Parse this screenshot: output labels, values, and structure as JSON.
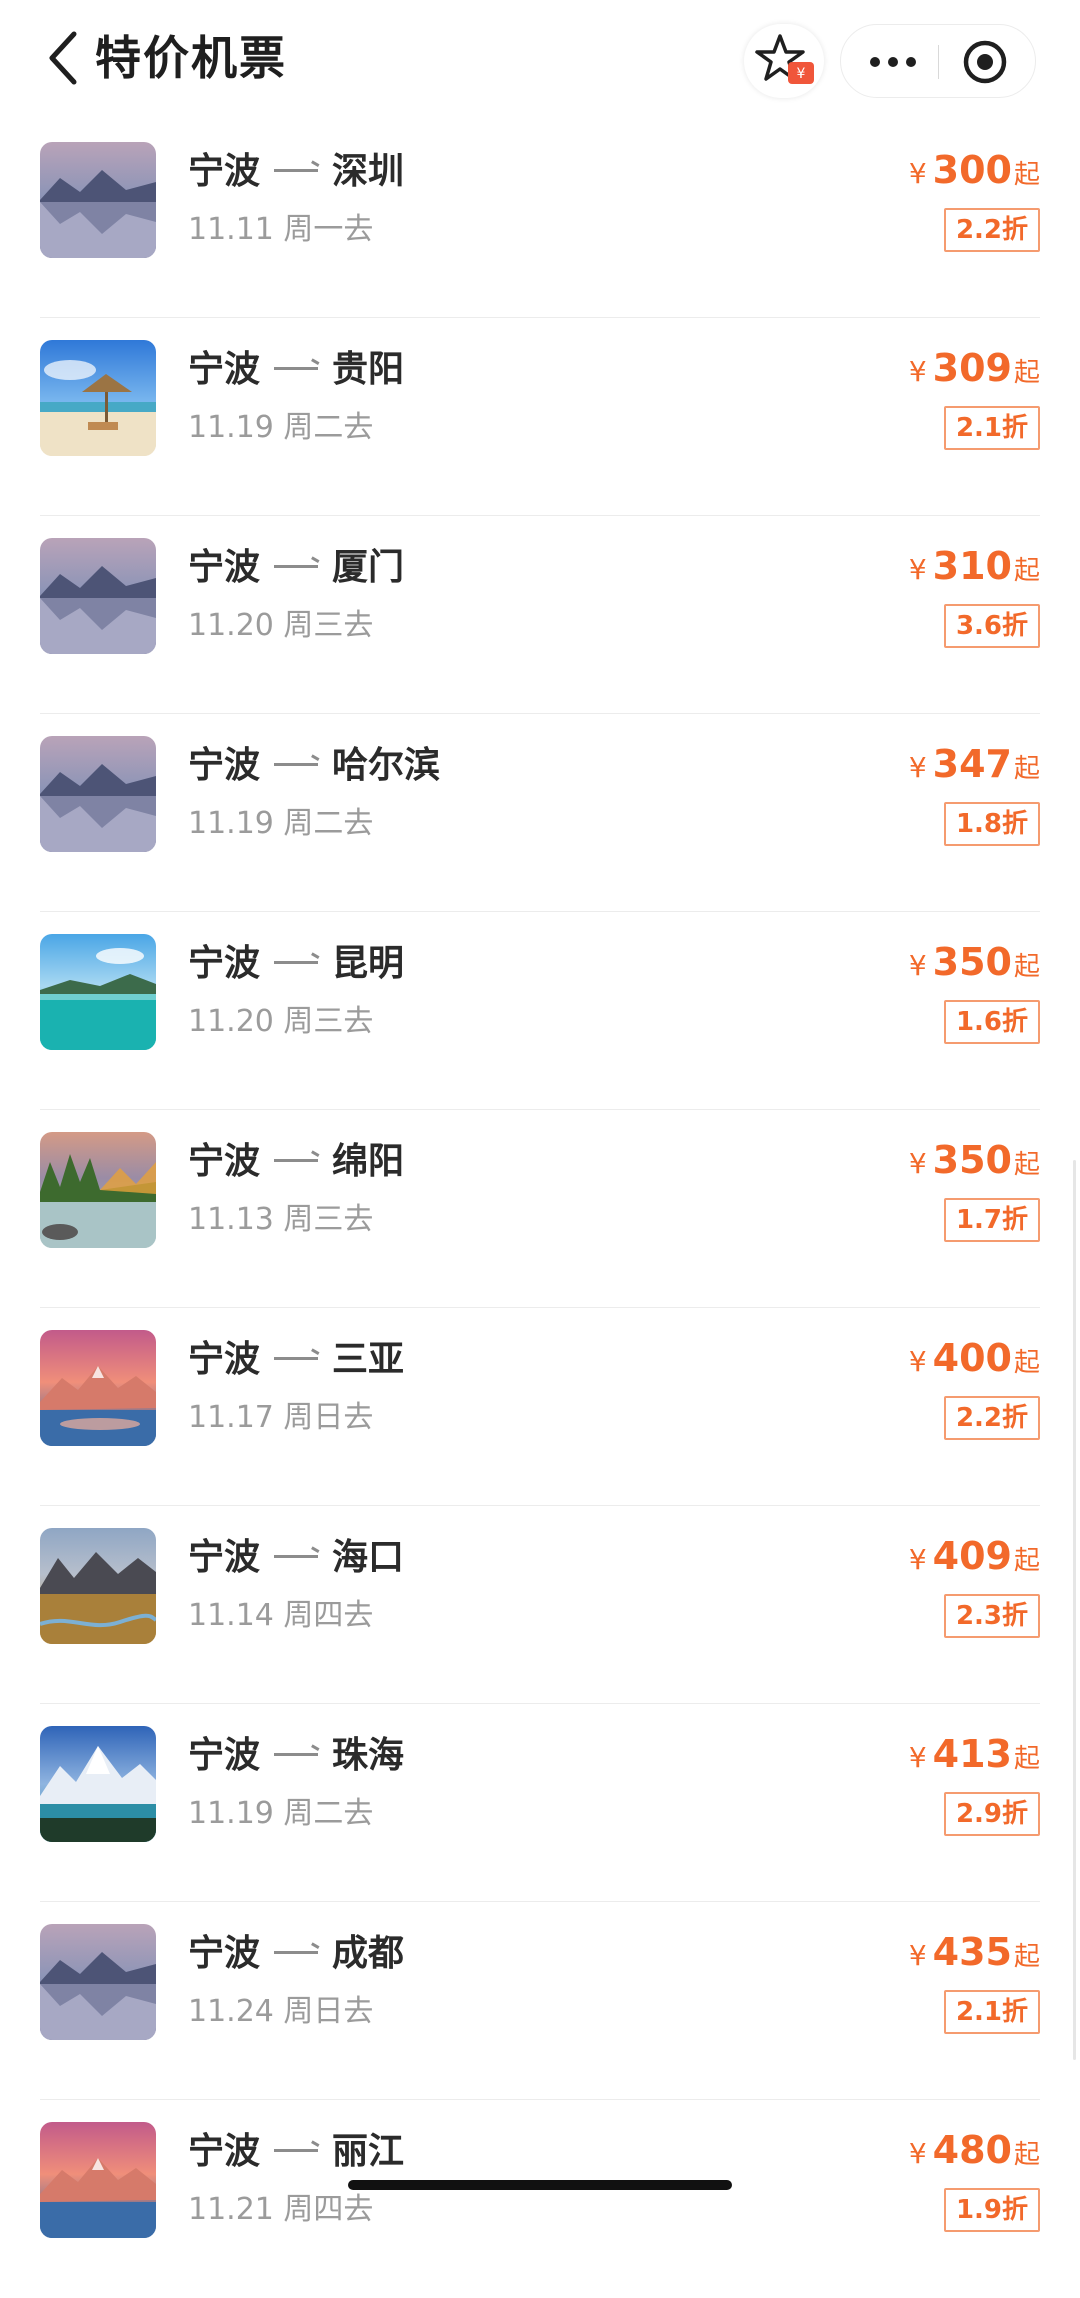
{
  "header": {
    "title": "特价机票",
    "icons": {
      "back": "back-chevron-icon",
      "favorite": "star-coupon-icon",
      "more": "more-dots-icon",
      "record": "target-icon"
    }
  },
  "colors": {
    "price": "#f2692a",
    "discount_border": "#f59b6f",
    "route_text": "#2b2b2b",
    "date_text": "#9b9b9b"
  },
  "flights": [
    {
      "from": "宁波",
      "to": "深圳",
      "date": "11.11 周一去",
      "currency": "¥",
      "price": "300",
      "suffix": "起",
      "discount": "2.2折",
      "thumb": "lake-mountain"
    },
    {
      "from": "宁波",
      "to": "贵阳",
      "date": "11.19 周二去",
      "currency": "¥",
      "price": "309",
      "suffix": "起",
      "discount": "2.1折",
      "thumb": "beach-umbrella"
    },
    {
      "from": "宁波",
      "to": "厦门",
      "date": "11.20 周三去",
      "currency": "¥",
      "price": "310",
      "suffix": "起",
      "discount": "3.6折",
      "thumb": "lake-mountain"
    },
    {
      "from": "宁波",
      "to": "哈尔滨",
      "date": "11.19 周二去",
      "currency": "¥",
      "price": "347",
      "suffix": "起",
      "discount": "1.8折",
      "thumb": "lake-mountain"
    },
    {
      "from": "宁波",
      "to": "昆明",
      "date": "11.20 周三去",
      "currency": "¥",
      "price": "350",
      "suffix": "起",
      "discount": "1.6折",
      "thumb": "turquoise-lake"
    },
    {
      "from": "宁波",
      "to": "绵阳",
      "date": "11.13 周三去",
      "currency": "¥",
      "price": "350",
      "suffix": "起",
      "discount": "1.7折",
      "thumb": "forest-river"
    },
    {
      "from": "宁波",
      "to": "三亚",
      "date": "11.17 周日去",
      "currency": "¥",
      "price": "400",
      "suffix": "起",
      "discount": "2.2折",
      "thumb": "pink-peaks"
    },
    {
      "from": "宁波",
      "to": "海口",
      "date": "11.14 周四去",
      "currency": "¥",
      "price": "409",
      "suffix": "起",
      "discount": "2.3折",
      "thumb": "desert-valley"
    },
    {
      "from": "宁波",
      "to": "珠海",
      "date": "11.19 周二去",
      "currency": "¥",
      "price": "413",
      "suffix": "起",
      "discount": "2.9折",
      "thumb": "snow-mountain"
    },
    {
      "from": "宁波",
      "to": "成都",
      "date": "11.24 周日去",
      "currency": "¥",
      "price": "435",
      "suffix": "起",
      "discount": "2.1折",
      "thumb": "lake-mountain"
    },
    {
      "from": "宁波",
      "to": "丽江",
      "date": "11.21 周四去",
      "currency": "¥",
      "price": "480",
      "suffix": "起",
      "discount": "1.9折",
      "thumb": "pink-peaks"
    }
  ]
}
